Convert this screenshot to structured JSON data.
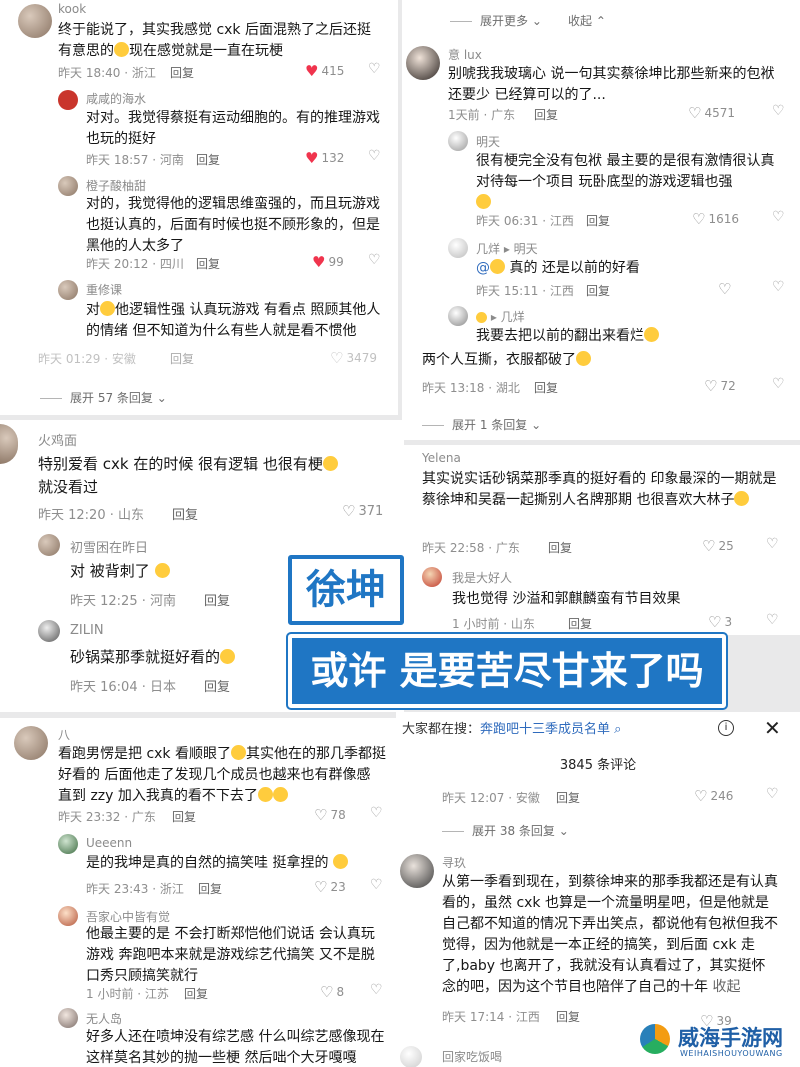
{
  "p1": {
    "c1": {
      "name": "kook",
      "text1": "终于能说了，其实我感觉 cxk 后面混熟了之后还挺",
      "text2": "有意思的",
      "text3": "现在感觉就是一直在玩梗",
      "time": "昨天 18:40 · 浙江",
      "reply": "回复",
      "likes": "415"
    },
    "c2": {
      "name": "咸咸的海水",
      "text": "对对。我觉得蔡挺有运动细胞的。有的推理游戏也玩的挺好",
      "time": "昨天 18:57 · 河南",
      "reply": "回复",
      "likes": "132"
    },
    "c3": {
      "name": "橙子酸柚甜",
      "text": "对的，我觉得他的逻辑思维蛮强的，而且玩游戏也挺认真的，后面有时候也挺不顾形象的，但是黑他的人太多了",
      "time": "昨天 20:12 · 四川",
      "reply": "回复",
      "likes": "99"
    },
    "c4": {
      "name": "重修课",
      "text1": "对",
      "text2": "他逻辑性强 认真玩游戏 有看点 照顾其他人的情绪 但不知道为什么有些人就是看不惯他",
      "time": "昨天 01:29 · 安徽",
      "reply": "回复",
      "likes": "3479"
    },
    "expand": "展开 57 条回复"
  },
  "p2": {
    "top_expand": "展开更多",
    "top_collapse": "收起",
    "c1": {
      "name": "意 lux",
      "text": "别唬我我玻璃心 说一句其实蔡徐坤比那些新来的包袱还要少 已经算可以的了...",
      "time": "1天前 · 广东",
      "reply": "回复",
      "likes": "4571"
    },
    "c2": {
      "name": "明天",
      "text": "很有梗完全没有包袱 最主要的是很有激情很认真对待每一个项目 玩卧底型的游戏逻辑也强",
      "time": "昨天 06:31 · 江西",
      "reply": "回复",
      "likes": "1616"
    },
    "c3": {
      "name": "几烊",
      "reply_to": "明天",
      "mention": "@",
      "text": "真的 还是以前的好看",
      "time": "昨天 15:11 · 江西",
      "reply": "回复"
    },
    "c4": {
      "name": "",
      "reply_to": "几烊",
      "text": "我要去把以前的翻出来看烂",
      "time": "",
      "reply": ""
    },
    "c5": {
      "text": "两个人互撕，衣服都破了",
      "time": "昨天 13:18 · 湖北",
      "reply": "回复",
      "likes": "72"
    },
    "expand": "展开 1 条回复"
  },
  "p3": {
    "c1": {
      "name": "火鸡面",
      "text": "特别爱看 cxk 在的时候 很有逻辑 也很有梗",
      "text2": "就没看过",
      "time": "昨天 12:20 · 山东",
      "reply": "回复",
      "likes": "371"
    },
    "c2": {
      "name": "初雪困在昨日",
      "text": "对 被背刺了",
      "time": "昨天 12:25 · 河南",
      "reply": "回复"
    },
    "c3": {
      "name": "ZILIN",
      "text": "砂锅菜那季就挺好看的",
      "time": "昨天 16:04 · 日本",
      "reply": "回复"
    }
  },
  "p4": {
    "c1": {
      "name": "Yelena",
      "text": "其实说实话砂锅菜那季真的挺好看的 印象最深的一期就是蔡徐坤和吴磊一起撕别人名牌那期 也很喜欢大林子",
      "time": "昨天 22:58 · 广东",
      "reply": "回复",
      "likes": "25"
    },
    "c2": {
      "name": "我是大好人",
      "text": "我也觉得 沙溢和郭麒麟蛮有节目效果",
      "time": "1 小时前 · 山东",
      "reply": "回复",
      "likes": "3"
    }
  },
  "banner": {
    "line1": "徐坤",
    "line2": "或许 是要苦尽甘来了吗"
  },
  "p5": {
    "c1": {
      "name": "八",
      "text1": "看跑男愣是把 cxk 看顺眼了",
      "text2": "其实他在的那几季都挺好看的 后面他走了发现几个成员也越来也有群像感 直到 zzy 加入我真的看不下去了",
      "time": "昨天 23:32 · 广东",
      "reply": "回复",
      "likes": "78"
    },
    "c2": {
      "name": "Ueeenn",
      "text": "是的我坤是真的自然的搞笑哇 挺拿捏的",
      "time": "昨天 23:43 · 浙江",
      "reply": "回复",
      "likes": "23"
    },
    "c3": {
      "name": "吾家心中皆有觉",
      "text": "他最主要的是 不会打断郑恺他们说话 会认真玩游戏 奔跑吧本来就是游戏综艺代搞笑 又不是脱口秀只顾搞笑就行",
      "time": "1 小时前 · 江苏",
      "reply": "回复",
      "likes": "8"
    },
    "c4": {
      "name": "无人岛",
      "text": "好多人还在喷坤没有综艺感 什么叫综艺感像现在这样莫名其妙的抛一些梗 然后咄个大牙嘎嘎"
    }
  },
  "p6": {
    "search_label": "大家都在搜：",
    "search_query": "奔跑吧十三季成员名单",
    "comment_count": "3845 条评论",
    "c0": {
      "time": "昨天 12:07 · 安徽",
      "reply": "回复",
      "likes": "246"
    },
    "expand": "展开 38 条回复",
    "c1": {
      "name": "寻玖",
      "text": "从第一季看到现在，到蔡徐坤来的那季我都还是有认真看的，虽然 cxk 也算是一个流量明星吧，但是他就是自己都不知道的情况下弄出笑点，都说他有包袱但我不觉得，因为他就是一本正经的搞笑，到后面 cxk 走了,baby 也离开了，我就没有认真看过了，其实挺怀念的吧，因为这个节目也陪伴了自己的十年",
      "collapse": "收起",
      "time": "昨天 17:14 · 江西",
      "reply": "回复",
      "likes": "39"
    },
    "c2": {
      "name": "回家吃饭喝"
    }
  },
  "watermark": {
    "cn": "威海手游网",
    "en": "WEIHAISHOUYOUWANG"
  },
  "colors": {
    "accent": "#1f76c4",
    "like_red": "#f0344d",
    "link": "#2f6bbd"
  }
}
